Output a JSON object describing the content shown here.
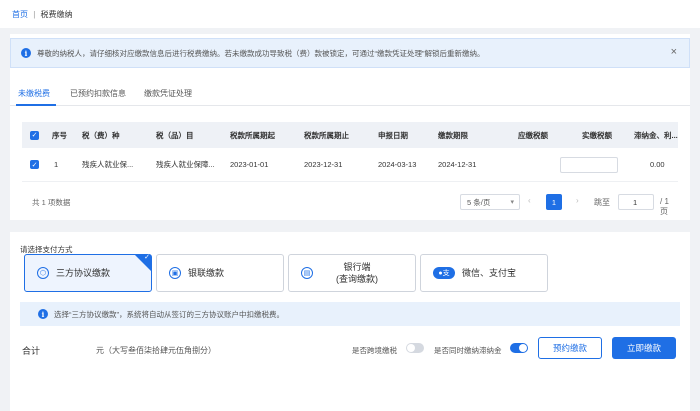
{
  "breadcrumb": {
    "home": "首页",
    "separator": "|",
    "current": "税费缴纳"
  },
  "notice": {
    "text": "尊敬的纳税人，请仔细核对应缴款信息后进行税费缴纳。若未缴款成功导致税（费）款被锁定，可通过“缴款凭证处理”解锁后重新缴纳。",
    "close": "×"
  },
  "tabs": [
    {
      "label": "未缴税费",
      "active": true
    },
    {
      "label": "已预约扣款信息",
      "active": false
    },
    {
      "label": "缴款凭证处理",
      "active": false
    }
  ],
  "table": {
    "headers": [
      "序号",
      "税（费）种",
      "税（品）目",
      "税款所属期起",
      "税款所属期止",
      "申报日期",
      "缴款期限",
      "应缴税额",
      "实缴税额",
      "滞纳金、利..."
    ],
    "rows": [
      {
        "checked": true,
        "index": "1",
        "tax_type": "残疾人就业保...",
        "tax_item": "残疾人就业保障...",
        "period_start": "2023-01-01",
        "period_end": "2023-12-31",
        "declare_date": "2024-03-13",
        "deadline": "2024-12-31",
        "payable": "",
        "paid": "",
        "late_fee": "0.00"
      }
    ]
  },
  "pagination": {
    "total_text": "共 1 项数据",
    "page_size": "5 条/页",
    "prev": "‹",
    "current_page": "1",
    "next": "›",
    "jump_label": "跳至",
    "jump_value": "1",
    "total_pages": "/ 1 页"
  },
  "payment": {
    "title": "请选择支付方式",
    "methods": [
      {
        "label": "三方协议缴款",
        "selected": true,
        "icon": "shield-icon"
      },
      {
        "label": "银联缴款",
        "selected": false,
        "icon": "card-icon"
      },
      {
        "label_line1": "银行端",
        "label_line2": "(查询缴款)",
        "selected": false,
        "icon": "bank-icon"
      },
      {
        "label": "微信、支付宝",
        "selected": false,
        "icon": "wechat-alipay-icon"
      }
    ],
    "notice": "选择“三方协议缴款”，系统将自动从签订的三方协议账户中扣缴税费。"
  },
  "footer": {
    "sum_label": "合计",
    "sum_text": "元（大写叁佰柒拾肆元伍角捌分）",
    "toggle1_label": "是否跨境缴税",
    "toggle1_on": false,
    "toggle2_label": "是否同时缴纳滞纳金",
    "toggle2_on": true,
    "reserve_button": "预约缴款",
    "pay_button": "立即缴款"
  },
  "colors": {
    "primary": "#1f6fe5",
    "notice_bg": "#e8f1fc",
    "page_bg": "#f0f2f5"
  }
}
